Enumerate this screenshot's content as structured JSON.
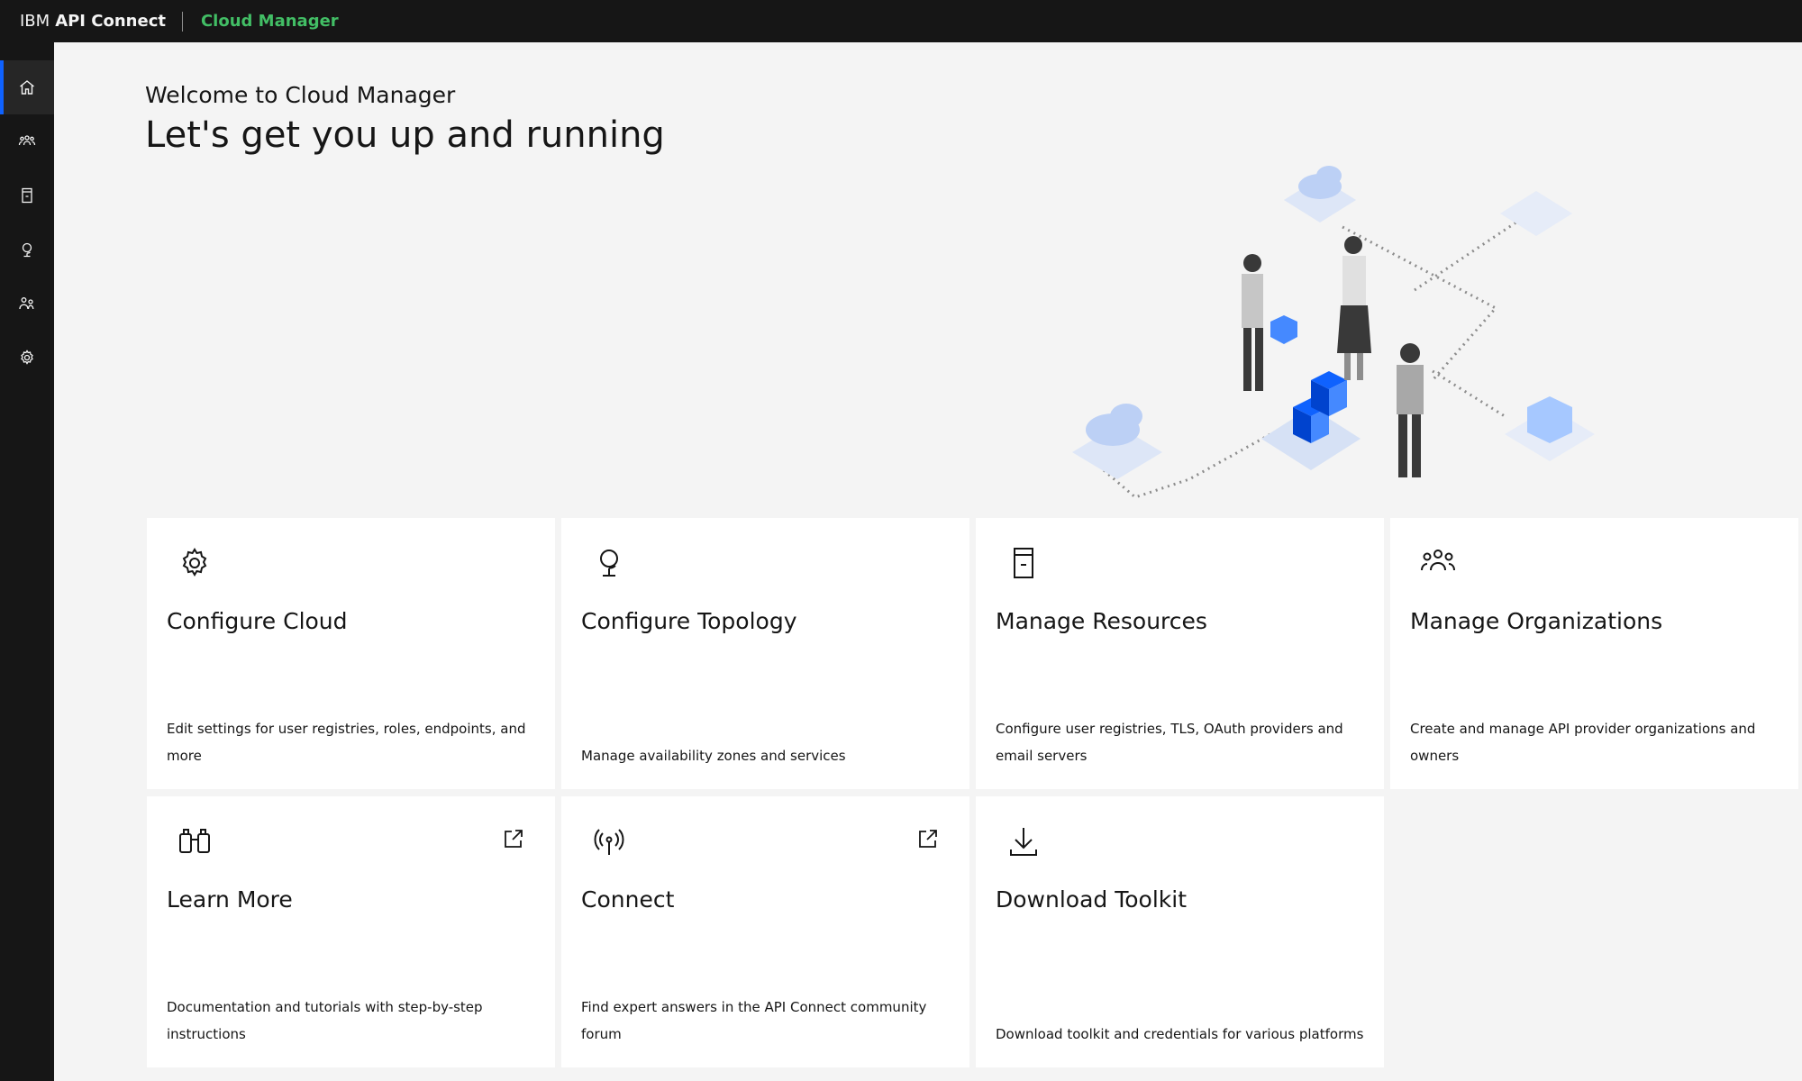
{
  "header": {
    "brand_ibm": "IBM",
    "brand_product": "API Connect",
    "app_name": "Cloud Manager"
  },
  "sidenav": {
    "items": [
      {
        "icon": "home-icon",
        "active": true
      },
      {
        "icon": "organizations-icon"
      },
      {
        "icon": "resources-icon"
      },
      {
        "icon": "topology-icon"
      },
      {
        "icon": "members-icon"
      },
      {
        "icon": "settings-icon"
      }
    ]
  },
  "main": {
    "welcome": "Welcome to Cloud Manager",
    "headline": "Let's get you up and running"
  },
  "tiles": [
    {
      "title": "Configure Cloud",
      "desc": "Edit settings for user registries, roles, endpoints, and more",
      "icon": "gear-icon"
    },
    {
      "title": "Configure Topology",
      "desc": "Manage availability zones and services",
      "icon": "globe-icon"
    },
    {
      "title": "Manage Resources",
      "desc": "Configure user registries, TLS, OAuth providers and email servers",
      "icon": "server-icon"
    },
    {
      "title": "Manage Organizations",
      "desc": "Create and manage API provider organizations and owners",
      "icon": "group-icon"
    },
    {
      "title": "Learn More",
      "desc": "Documentation and tutorials with step-by-step instructions",
      "icon": "binoculars-icon",
      "external": true
    },
    {
      "title": "Connect",
      "desc": "Find expert answers in the API Connect community forum",
      "icon": "antenna-icon",
      "external": true
    },
    {
      "title": "Download Toolkit",
      "desc": "Download toolkit and credentials for various platforms",
      "icon": "download-icon"
    }
  ],
  "colors": {
    "header_bg": "#161616",
    "accent_green": "#42be65",
    "active_blue": "#0f62fe",
    "cube_blue": "#0f62fe"
  }
}
